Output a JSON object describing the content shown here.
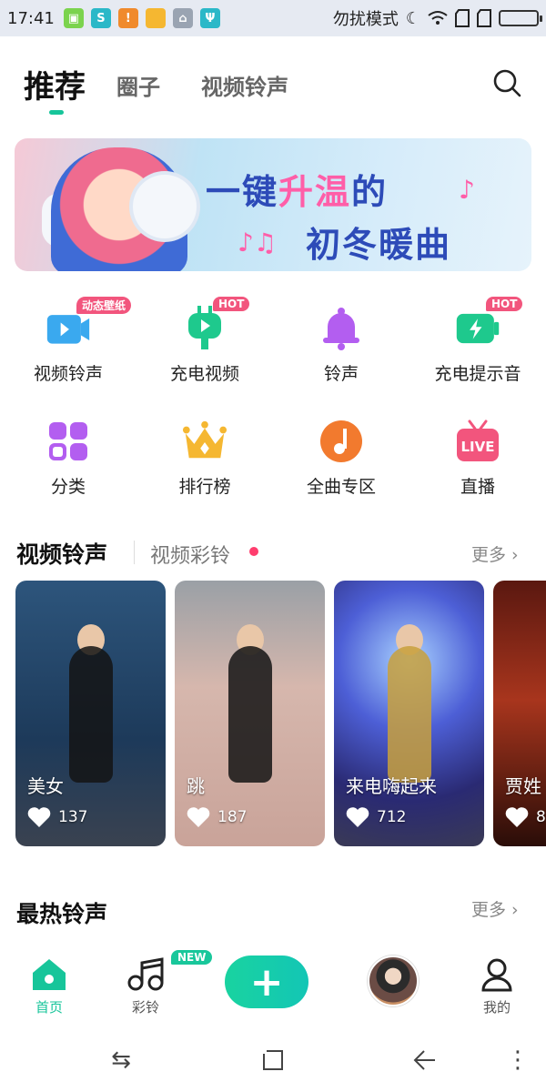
{
  "status_bar": {
    "time": "17:41",
    "dnd_text": "勿扰模式",
    "icons": [
      "notification-green-icon",
      "app-teal-icon",
      "warning-icon",
      "folder-icon",
      "broom-icon",
      "usb-icon",
      "moon-icon",
      "wifi-icon",
      "sim1-icon",
      "sim2-icon",
      "battery-icon"
    ]
  },
  "top_nav": {
    "active_tab": "推荐",
    "tabs": [
      "推荐",
      "圈子",
      "视频铃声"
    ],
    "search_icon": "search-icon",
    "accent_color": "#17c59a"
  },
  "banner": {
    "line1_a": "一键",
    "line1_b": "升温",
    "line1_c": "的",
    "line2": "初冬暖曲",
    "note1": "♪♫",
    "note2": "♪"
  },
  "features": [
    {
      "label": "视频铃声",
      "icon": "video-ringtone-icon",
      "badge": "动态壁纸"
    },
    {
      "label": "充电视频",
      "icon": "charge-video-icon",
      "badge": "HOT"
    },
    {
      "label": "铃声",
      "icon": "bell-icon",
      "badge": ""
    },
    {
      "label": "充电提示音",
      "icon": "charge-sound-icon",
      "badge": "HOT"
    },
    {
      "label": "分类",
      "icon": "category-icon",
      "badge": ""
    },
    {
      "label": "排行榜",
      "icon": "crown-icon",
      "badge": ""
    },
    {
      "label": "全曲专区",
      "icon": "music-note-icon",
      "badge": ""
    },
    {
      "label": "直播",
      "icon": "live-tv-icon",
      "badge": ""
    }
  ],
  "live_icon_text": "LIVE",
  "video_section": {
    "title": "视频铃声",
    "sub_tab": "视频彩铃",
    "more": "更多 ›",
    "cards": [
      {
        "title": "美女",
        "likes": "137",
        "bg": "#2f5f88"
      },
      {
        "title": "跳",
        "likes": "187",
        "bg": "#c4a79f"
      },
      {
        "title": "来电嗨起来",
        "likes": "712",
        "bg": "#3e3f94"
      },
      {
        "title": "贾姓",
        "likes": "8",
        "bg": "#6a1f15"
      }
    ]
  },
  "hot_section": {
    "title": "最热铃声",
    "more": "更多 ›"
  },
  "bottom_nav": {
    "items": [
      {
        "label": "首页",
        "icon": "home-icon",
        "active": true
      },
      {
        "label": "彩铃",
        "icon": "music-notes-icon",
        "badge": "NEW"
      },
      {
        "label": "",
        "icon": "plus-icon"
      },
      {
        "label": "",
        "icon": "avatar"
      },
      {
        "label": "我的",
        "icon": "profile-icon"
      }
    ],
    "plus_symbol": "+"
  },
  "system_nav": {
    "buttons": [
      "switch-icon",
      "home-square-icon",
      "back-icon",
      "menu-icon"
    ]
  }
}
